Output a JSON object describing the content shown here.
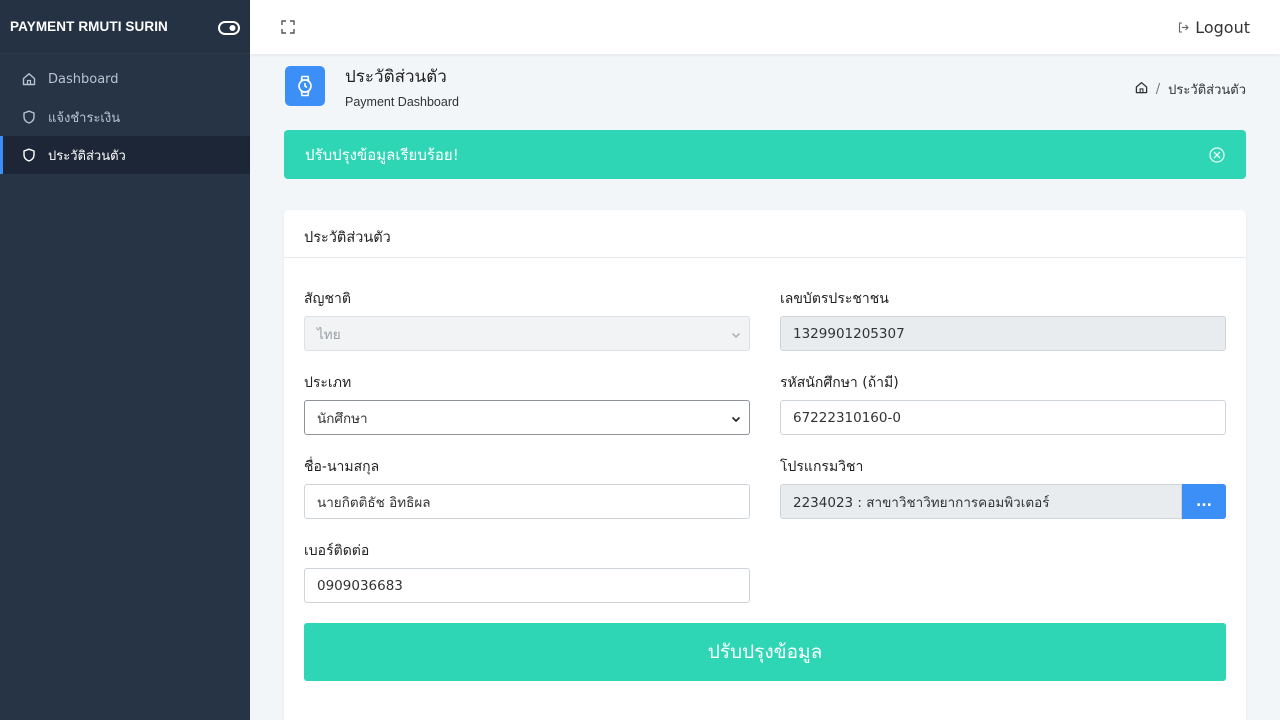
{
  "sidebar": {
    "brand": "PAYMENT RMUTI SURIN",
    "items": [
      {
        "label": "Dashboard",
        "icon": "home-icon"
      },
      {
        "label": "แจ้งชำระเงิน",
        "icon": "shield-icon"
      },
      {
        "label": "ประวัติส่วนตัว",
        "icon": "shield-icon",
        "active": true
      }
    ]
  },
  "topbar": {
    "logout_label": "Logout"
  },
  "page": {
    "title": "ประวัติส่วนตัว",
    "subtitle": "Payment Dashboard",
    "breadcrumb": "ประวัติส่วนตัว"
  },
  "alert": {
    "message": "ปรับปรุงข้อมูลเรียบร้อย!"
  },
  "card": {
    "title": "ประวัติส่วนตัว"
  },
  "form": {
    "nationality": {
      "label": "สัญชาติ",
      "value": "ไทย"
    },
    "id_card": {
      "label": "เลขบัตรประชาชน",
      "value": "1329901205307"
    },
    "type": {
      "label": "ประเภท",
      "value": "นักศึกษา"
    },
    "student_id": {
      "label": "รหัสนักศึกษา (ถ้ามี)",
      "value": "67222310160-0"
    },
    "fullname": {
      "label": "ชื่อ-นามสกุล",
      "value": "นายกิตติธัช อิทธิผล"
    },
    "program": {
      "label": "โปรแกรมวิชา",
      "value": "2234023 : สาขาวิชาวิทยาการคอมพิวเตอร์",
      "button": "..."
    },
    "phone": {
      "label": "เบอร์ติดต่อ",
      "value": "0909036683"
    },
    "submit_label": "ปรับปรุงข้อมูล"
  },
  "colors": {
    "sidebar_bg": "#263445",
    "accent_blue": "#3b8ff6",
    "success_teal": "#2fd6b5"
  }
}
